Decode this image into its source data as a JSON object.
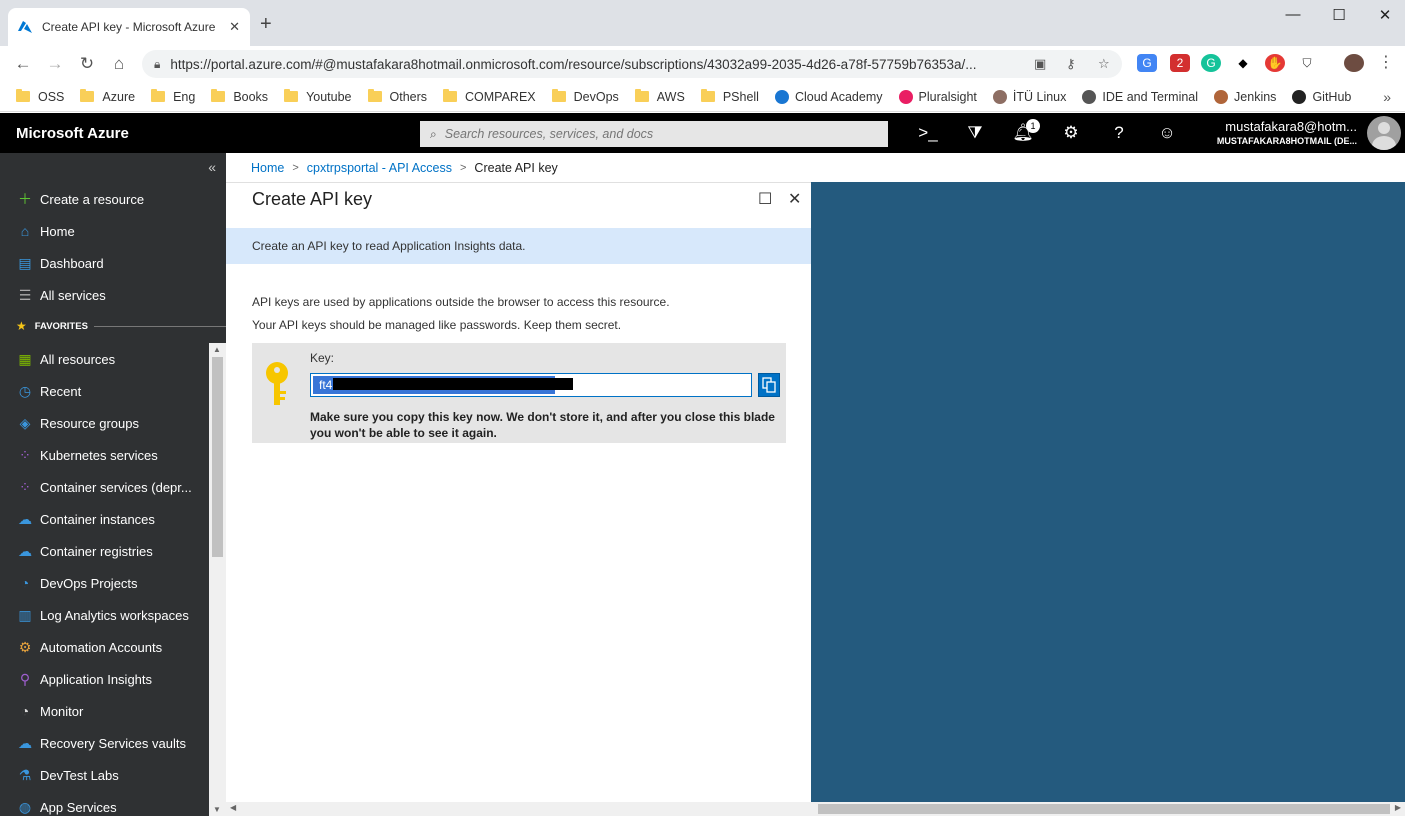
{
  "browser": {
    "tab_title": "Create API key - Microsoft Azure",
    "tab_close": "✕",
    "new_tab": "+",
    "url": "https://portal.azure.com/#@mustafakara8hotmail.onmicrosoft.com/resource/subscriptions/43032a99-2035-4d26-a78f-57759b76353a/...",
    "window": {
      "minimize": "—",
      "maximize": "☐",
      "close": "✕"
    },
    "ext_badge": "2",
    "bookmarks": [
      "OSS",
      "Azure",
      "Eng",
      "Books",
      "Youtube",
      "Others",
      "COMPAREX",
      "DevOps",
      "AWS",
      "PShell",
      "Cloud Academy",
      "Pluralsight",
      "İTÜ Linux",
      "IDE and Terminal",
      "Jenkins",
      "GitHub"
    ],
    "more_bookmarks": "»"
  },
  "azure": {
    "brand": "Microsoft Azure",
    "search_placeholder": "Search resources, services, and docs",
    "notification_count": "1",
    "account_name": "mustafakara8@hotm...",
    "account_dir": "MUSTAFAKARA8HOTMAIL (DE..."
  },
  "sidebar": {
    "collapse": "«",
    "top_items": [
      "Create a resource",
      "Home",
      "Dashboard",
      "All services"
    ],
    "favorites_label": "FAVORITES",
    "favorites": [
      "All resources",
      "Recent",
      "Resource groups",
      "Kubernetes services",
      "Container services (depr...",
      "Container instances",
      "Container registries",
      "DevOps Projects",
      "Log Analytics workspaces",
      "Automation Accounts",
      "Application Insights",
      "Monitor",
      "Recovery Services vaults",
      "DevTest Labs",
      "App Services"
    ]
  },
  "breadcrumb": {
    "home": "Home",
    "parent": "cpxtrpsportal - API Access",
    "current": "Create API key",
    "sep": ">"
  },
  "blade": {
    "title": "Create API key",
    "info": "Create an API key to read Application Insights data.",
    "desc1": "API keys are used by applications outside the browser to access this resource.",
    "desc2": "Your API keys should be managed like passwords. Keep them secret.",
    "key_label": "Key:",
    "key_value_prefix": "ft4",
    "warning": "Make sure you copy this key now. We don't store it, and after you close this blade you won't be able to see it again."
  },
  "colors": {
    "accent": "#0072c6",
    "sidebar_bg": "#2f3133",
    "pane_bg": "#245a7e",
    "info_bg": "#d7e8fb"
  }
}
